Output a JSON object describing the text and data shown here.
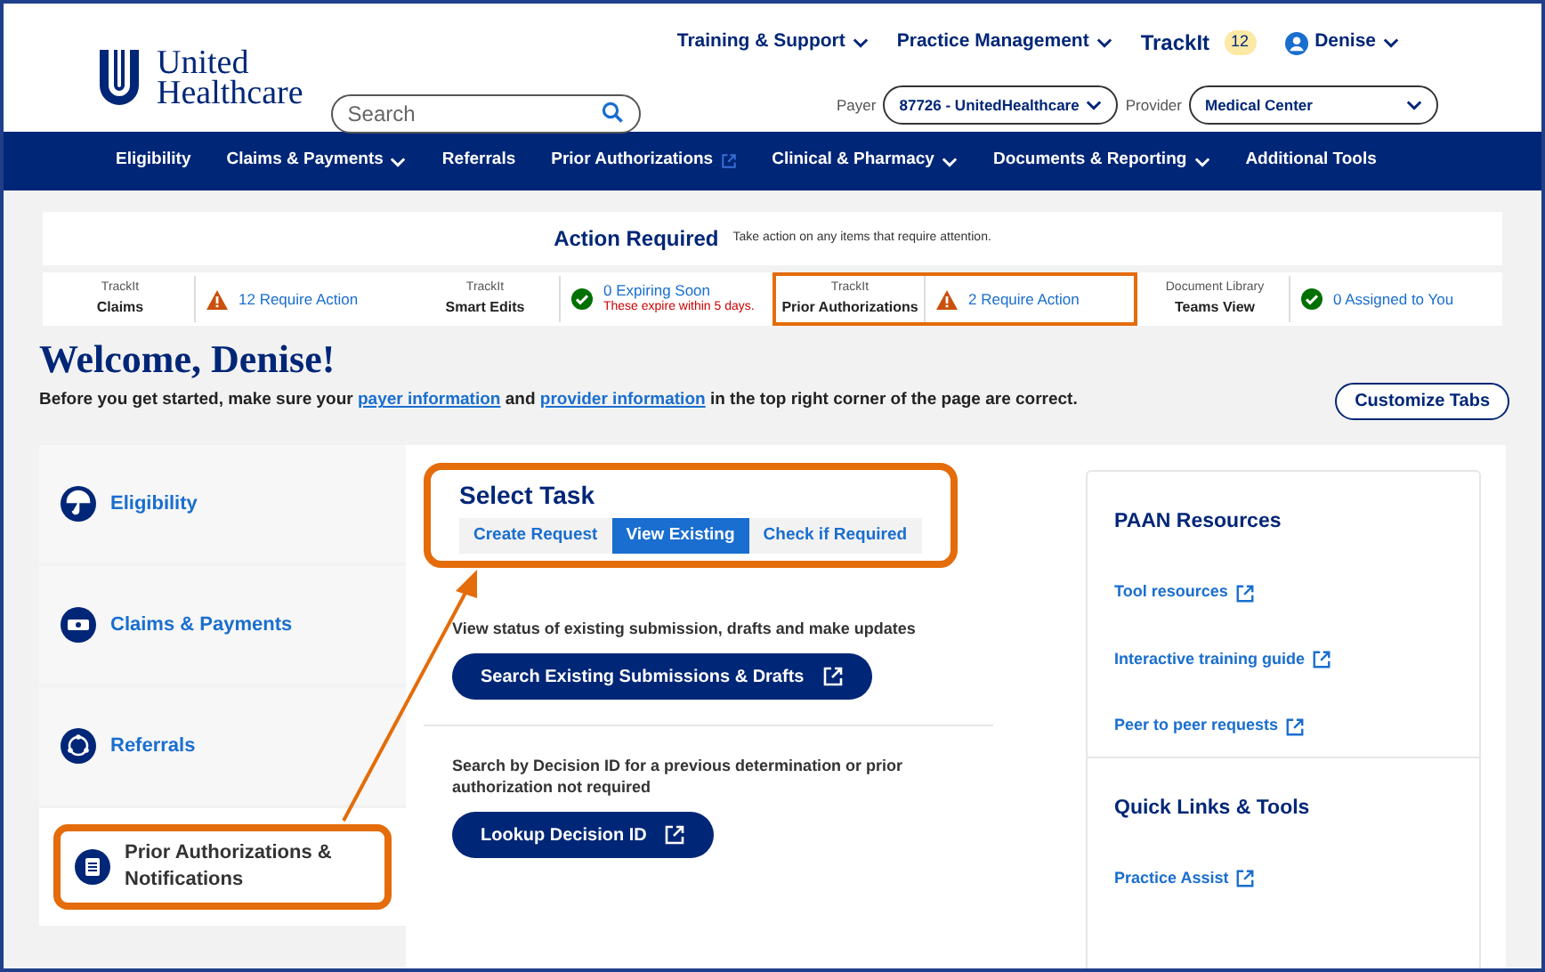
{
  "header": {
    "logo": [
      "United",
      "Healthcare"
    ],
    "search": {
      "placeholder": "Search"
    },
    "top_links": [
      {
        "label": "Training & Support",
        "dropdown": true
      },
      {
        "label": "Practice Management",
        "dropdown": true
      }
    ],
    "trackit": {
      "label": "TrackIt",
      "count": "12"
    },
    "user": {
      "name": "Denise",
      "dropdown": true
    },
    "payer": {
      "label": "Payer",
      "value": "87726 - UnitedHealthcare"
    },
    "provider": {
      "label": "Provider",
      "value": "Medical Center"
    }
  },
  "nav": [
    {
      "label": "Eligibility",
      "dropdown": false,
      "external": false
    },
    {
      "label": "Claims & Payments",
      "dropdown": true,
      "external": false
    },
    {
      "label": "Referrals",
      "dropdown": false,
      "external": false
    },
    {
      "label": "Prior Authorizations",
      "dropdown": false,
      "external": true
    },
    {
      "label": "Clinical & Pharmacy",
      "dropdown": true,
      "external": false
    },
    {
      "label": "Documents & Reporting",
      "dropdown": true,
      "external": false
    },
    {
      "label": "Additional Tools",
      "dropdown": false,
      "external": false
    }
  ],
  "action_required": {
    "title": "Action Required",
    "note": "Take action on any items that require attention."
  },
  "trackit_groups": [
    {
      "source_top": "TrackIt",
      "source": "Claims",
      "kind": "warning",
      "status": "12 Require Action",
      "highlighted": false
    },
    {
      "source_top": "TrackIt",
      "source": "Smart Edits",
      "kind": "ok",
      "status": "0 Expiring Soon",
      "note": "These expire within 5 days.",
      "highlighted": false
    },
    {
      "source_top": "TrackIt",
      "source": "Prior Authorizations",
      "kind": "warning",
      "status": "2 Require Action",
      "highlighted": true
    },
    {
      "source_top": "Document Library",
      "source": "Teams View",
      "kind": "ok",
      "status": "0 Assigned to You",
      "highlighted": false
    }
  ],
  "welcome": {
    "title": "Welcome, Denise!",
    "intro": [
      {
        "text": "Before you get started, make sure your ",
        "link": false
      },
      {
        "text": "payer information",
        "link": true
      },
      {
        "text": " and ",
        "link": false
      },
      {
        "text": "provider information",
        "link": true
      },
      {
        "text": " in the top right corner of the page are correct.",
        "link": false
      }
    ],
    "button": "Customize Tabs"
  },
  "sidebar": [
    {
      "label": "Eligibility",
      "kind": "umbrella",
      "selected": false,
      "annotated": false
    },
    {
      "label": "Claims & Payments",
      "kind": "money",
      "selected": false,
      "annotated": false
    },
    {
      "label": "Referrals",
      "kind": "network",
      "selected": false,
      "annotated": false
    },
    {
      "label": "Prior Authorizations & Notifications",
      "kind": "clipboard",
      "selected": true,
      "annotated": true
    }
  ],
  "select_task": {
    "title": "Select Task",
    "annotated": true,
    "tabs": [
      {
        "label": "Create Request",
        "selected": false
      },
      {
        "label": "View Existing",
        "selected": true
      },
      {
        "label": "Check if Required",
        "selected": false
      }
    ]
  },
  "task_sections": [
    {
      "text": "View status of existing submission, drafts and make updates",
      "button": "Search Existing Submissions & Drafts"
    },
    {
      "text": "Search by Decision ID for a previous determination or prior authorization not required",
      "button": "Lookup Decision ID"
    }
  ],
  "resources": [
    {
      "title": "PAAN Resources",
      "links": [
        "Tool resources",
        "Interactive training guide",
        "Peer to peer requests"
      ]
    },
    {
      "title": "Quick Links & Tools",
      "links": [
        "Practice Assist"
      ]
    }
  ]
}
